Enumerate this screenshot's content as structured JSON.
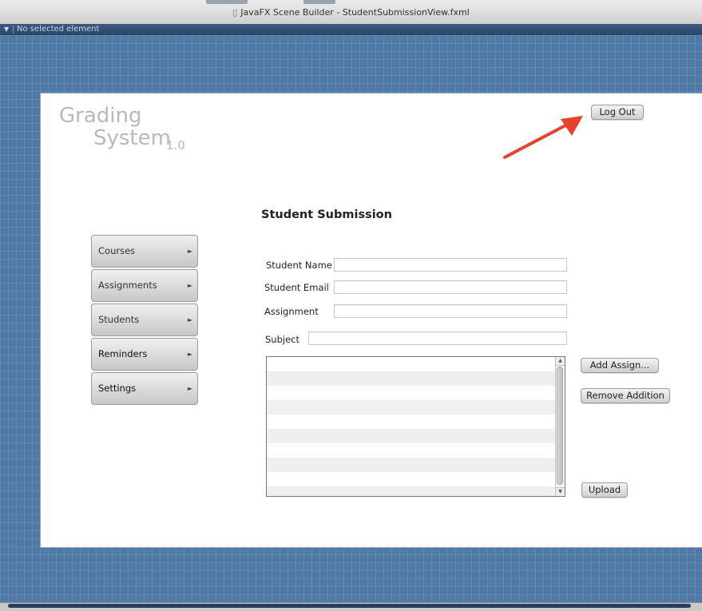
{
  "window": {
    "title": "JavaFX Scene Builder - StudentSubmissionView.fxml",
    "doc_icon": "doc-icon"
  },
  "statusbar": {
    "text": "No selected element",
    "toggle_icon": "triangle-down-icon"
  },
  "app": {
    "logo_line1": "Grading",
    "logo_line2": "System",
    "logo_version": "1.0",
    "logout_label": "Log Out",
    "heading": "Student Submission"
  },
  "nav": {
    "items": [
      {
        "label": "Courses"
      },
      {
        "label": "Assignments"
      },
      {
        "label": "Students"
      },
      {
        "label": "Reminders"
      },
      {
        "label": "Settings"
      }
    ],
    "arrow_icon": "triangle-right-icon"
  },
  "form": {
    "student_name_label": "Student Name",
    "student_email_label": "Student Email",
    "assignment_label": "Assignment",
    "subject_label": "Subject",
    "student_name_value": "",
    "student_email_value": "",
    "assignment_value": "",
    "subject_value": ""
  },
  "actions": {
    "add_label": "Add Assign...",
    "remove_label": "Remove Addition",
    "upload_label": "Upload"
  },
  "colors": {
    "canvas": "#4f7aa6",
    "annotation_arrow": "#e8412c"
  }
}
